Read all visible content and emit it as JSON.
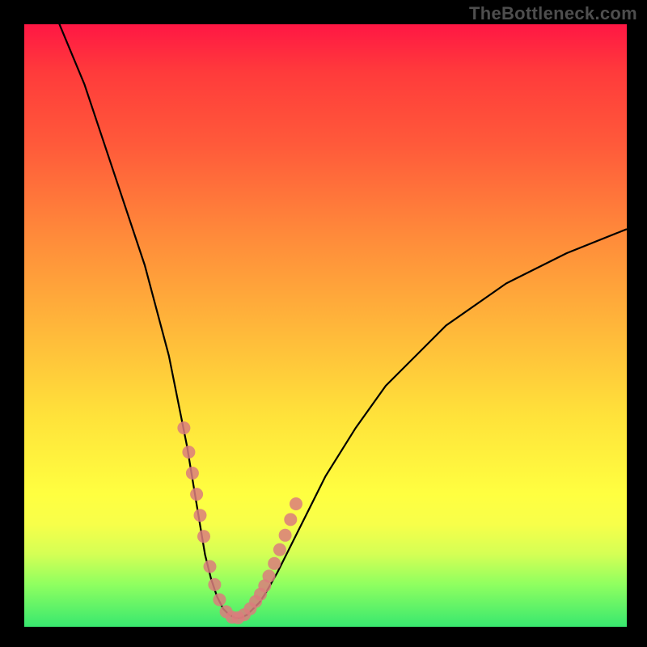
{
  "watermark": "TheBottleneck.com",
  "colors": {
    "page_bg": "#000000",
    "gradient_top": "#ff1744",
    "gradient_mid": "#ffe23a",
    "gradient_bottom": "#38e86f",
    "curve_stroke": "#000000",
    "dot_fill": "#db7d7d"
  },
  "chart_data": {
    "type": "line",
    "title": "",
    "xlabel": "",
    "ylabel": "",
    "xlim": [
      0,
      100
    ],
    "ylim": [
      0,
      100
    ],
    "grid": false,
    "legend": false,
    "series": [
      {
        "name": "bottleneck-curve",
        "x": [
          5,
          10,
          15,
          20,
          24,
          27,
          29,
          30,
          31,
          32,
          33,
          34,
          35,
          36,
          37,
          38,
          39,
          40,
          42,
          45,
          50,
          55,
          60,
          70,
          80,
          90,
          100
        ],
        "y": [
          102,
          90,
          75,
          60,
          45,
          30,
          18,
          12,
          8,
          5,
          3,
          2,
          1.5,
          1.5,
          2,
          3,
          4,
          5.5,
          9,
          15,
          25,
          33,
          40,
          50,
          57,
          62,
          66
        ]
      }
    ],
    "highlight_dots": {
      "name": "sample-points",
      "x": [
        26.5,
        27.3,
        27.9,
        28.6,
        29.2,
        29.8,
        30.8,
        31.6,
        32.4,
        33.5,
        34.5,
        35.5,
        36.5,
        37.5,
        38.4,
        39.2,
        39.9,
        40.6,
        41.5,
        42.4,
        43.3,
        44.2,
        45.1
      ],
      "y": [
        33,
        29,
        25.5,
        22,
        18.5,
        15,
        10,
        7,
        4.5,
        2.5,
        1.6,
        1.5,
        2,
        3,
        4.2,
        5.4,
        6.8,
        8.4,
        10.5,
        12.8,
        15.2,
        17.8,
        20.4
      ]
    }
  }
}
